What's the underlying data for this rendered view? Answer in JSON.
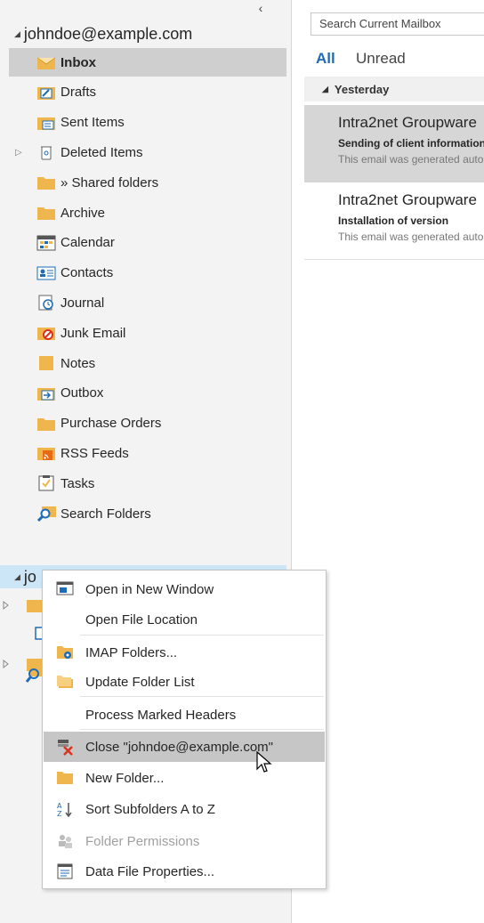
{
  "folder_pane": {
    "collapse_glyph": "‹",
    "account1": {
      "name": "johndoe@example.com"
    },
    "folders": [
      {
        "label": "Inbox",
        "icon": "inbox-icon",
        "selected": true,
        "expander": ""
      },
      {
        "label": "Drafts",
        "icon": "drafts-icon",
        "expander": ""
      },
      {
        "label": "Sent Items",
        "icon": "sent-items-icon",
        "expander": ""
      },
      {
        "label": "Deleted Items",
        "icon": "trash-icon",
        "expander": "▷"
      },
      {
        "label": "» Shared folders",
        "icon": "folder-icon",
        "expander": ""
      },
      {
        "label": "Archive",
        "icon": "folder-icon",
        "expander": ""
      },
      {
        "label": "Calendar",
        "icon": "calendar-icon",
        "expander": ""
      },
      {
        "label": "Contacts",
        "icon": "contacts-icon",
        "expander": ""
      },
      {
        "label": "Journal",
        "icon": "journal-icon",
        "expander": ""
      },
      {
        "label": "Junk Email",
        "icon": "junk-email-icon",
        "expander": ""
      },
      {
        "label": "Notes",
        "icon": "notes-icon",
        "expander": ""
      },
      {
        "label": "Outbox",
        "icon": "outbox-icon",
        "expander": ""
      },
      {
        "label": "Purchase Orders",
        "icon": "folder-icon",
        "expander": ""
      },
      {
        "label": "RSS Feeds",
        "icon": "rss-feeds-icon",
        "expander": ""
      },
      {
        "label": "Tasks",
        "icon": "tasks-icon",
        "expander": ""
      },
      {
        "label": "Search Folders",
        "icon": "search-folders-icon",
        "expander": ""
      }
    ],
    "account2": {
      "name": "jo"
    }
  },
  "mail_list": {
    "search_placeholder": "Search Current Mailbox",
    "filters": {
      "all": "All",
      "unread": "Unread"
    },
    "group_label": "Yesterday",
    "items": [
      {
        "sender": "Intra2net Groupware",
        "subject": "Sending of client information",
        "preview": "This email was generated automatically",
        "selected": true
      },
      {
        "sender": "Intra2net Groupware",
        "subject": "Installation of version",
        "preview": "This email was generated automatically",
        "selected": false
      }
    ]
  },
  "context_menu": {
    "items": [
      {
        "key": "open_new_window",
        "label": "Open in New Window",
        "icon": "new-window-icon",
        "disabled": false,
        "highlighted": false
      },
      {
        "key": "open_file_location",
        "label": "Open File Location",
        "icon": "",
        "disabled": false,
        "highlighted": false
      },
      {
        "key": "imap_folders",
        "label": "IMAP Folders...",
        "icon": "imap-folders-icon",
        "disabled": false,
        "highlighted": false
      },
      {
        "key": "update_folder_list",
        "label": "Update Folder List",
        "icon": "update-folder-list-icon",
        "disabled": false,
        "highlighted": false
      },
      {
        "key": "process_marked_headers",
        "label": "Process Marked Headers",
        "icon": "",
        "disabled": false,
        "highlighted": false
      },
      {
        "key": "close_account",
        "label": "Close \"johndoe@example.com\"",
        "icon": "close-data-file-icon",
        "disabled": false,
        "highlighted": true
      },
      {
        "key": "new_folder",
        "label": "New Folder...",
        "icon": "folder-icon",
        "disabled": false,
        "highlighted": false
      },
      {
        "key": "sort_subfolders",
        "label": "Sort Subfolders A to Z",
        "icon": "sort-az-icon",
        "disabled": false,
        "highlighted": false
      },
      {
        "key": "folder_permissions",
        "label": "Folder Permissions",
        "icon": "permissions-icon",
        "disabled": true,
        "highlighted": false
      },
      {
        "key": "data_file_properties",
        "label": "Data File Properties...",
        "icon": "properties-icon",
        "disabled": false,
        "highlighted": false
      }
    ]
  },
  "colors": {
    "accent": "#1e6cb7",
    "selection": "#cfcfcf",
    "menu_highlight": "#c6c6c6",
    "account_highlight": "#cde6f7"
  }
}
